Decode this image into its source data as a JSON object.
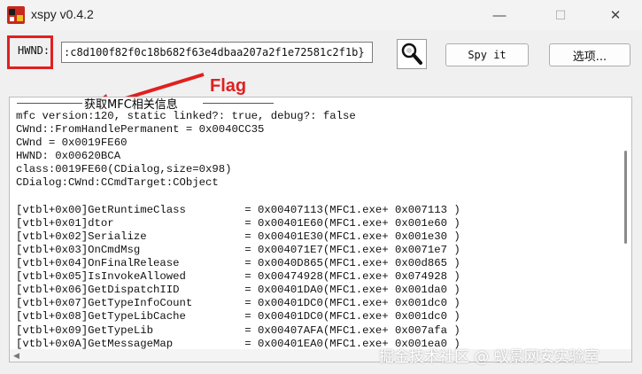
{
  "window": {
    "title": "xspy v0.4.2",
    "minimize": "—",
    "maximize": "☐",
    "close": "✕"
  },
  "hwnd": {
    "label": "HWND:",
    "value": ":c8d100f82f0c18b682f63e4dbaa207a2f1e72581c2f1b}"
  },
  "buttons": {
    "spy": "Spy it",
    "options": "选项..."
  },
  "annotation": {
    "flag": "Flag"
  },
  "output": {
    "group_title": "获取MFC相关信息",
    "lines": [
      "mfc version:120, static linked?: true, debug?: false",
      "CWnd::FromHandlePermanent = 0x0040CC35",
      "CWnd = 0x0019FE60",
      "HWND: 0x00620BCA",
      "class:0019FE60(CDialog,size=0x98)",
      "CDialog:CWnd:CCmdTarget:CObject",
      "",
      "[vtbl+0x00]GetRuntimeClass         = 0x00407113(MFC1.exe+ 0x007113 )",
      "[vtbl+0x01]dtor                    = 0x00401E60(MFC1.exe+ 0x001e60 )",
      "[vtbl+0x02]Serialize               = 0x00401E30(MFC1.exe+ 0x001e30 )",
      "[vtbl+0x03]OnCmdMsg                = 0x004071E7(MFC1.exe+ 0x0071e7 )",
      "[vtbl+0x04]OnFinalRelease          = 0x0040D865(MFC1.exe+ 0x00d865 )",
      "[vtbl+0x05]IsInvokeAllowed         = 0x00474928(MFC1.exe+ 0x074928 )",
      "[vtbl+0x06]GetDispatchIID          = 0x00401DA0(MFC1.exe+ 0x001da0 )",
      "[vtbl+0x07]GetTypeInfoCount        = 0x00401DC0(MFC1.exe+ 0x001dc0 )",
      "[vtbl+0x08]GetTypeLibCache         = 0x00401DC0(MFC1.exe+ 0x001dc0 )",
      "[vtbl+0x09]GetTypeLib              = 0x00407AFA(MFC1.exe+ 0x007afa )",
      "[vtbl+0x0A]GetMessageMap           = 0x00401EA0(MFC1.exe+ 0x001ea0 )"
    ]
  },
  "watermark": "掘金技术社区 @ 蚁景网安实验室",
  "colors": {
    "annotation": "#e02020",
    "background": "#f0f0f0"
  }
}
